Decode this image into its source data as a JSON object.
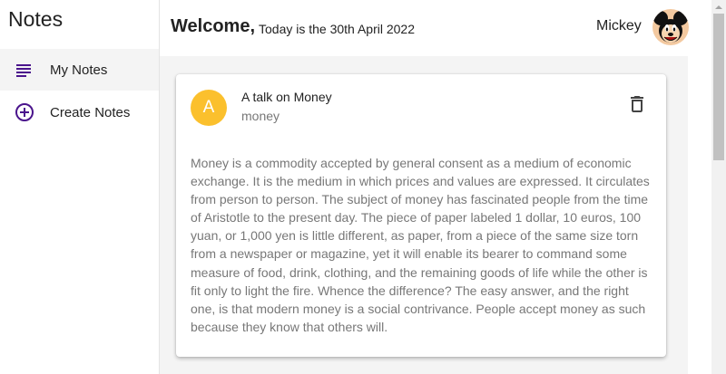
{
  "sidebar": {
    "app_title": "Notes",
    "items": [
      {
        "label": "My Notes",
        "icon": "list-icon",
        "active": true
      },
      {
        "label": "Create Notes",
        "icon": "add-circle-icon",
        "active": false
      }
    ]
  },
  "header": {
    "welcome": "Welcome,",
    "date_text": "Today is the 30th April 2022",
    "username": "Mickey"
  },
  "note": {
    "avatar_letter": "A",
    "title": "A talk on Money",
    "category": "money",
    "body": "Money is a commodity accepted by general consent as a medium of economic exchange. It is the medium in which prices and values are expressed. It circulates from person to person. The subject of money has fascinated people from the time of Aristotle to the present day. The piece of paper labeled 1 dollar, 10 euros, 100 yuan, or 1,000 yen is little different, as paper, from a piece of the same size torn from a newspaper or magazine, yet it will enable its bearer to command some measure of food, drink, clothing, and the remaining goods of life while the other is fit only to light the fire. Whence the difference? The easy answer, and the right one, is that modern money is a social contrivance. People accept money as such because they know that others will."
  },
  "colors": {
    "accent_purple": "#4a148c",
    "avatar_yellow": "#fbc02d"
  }
}
